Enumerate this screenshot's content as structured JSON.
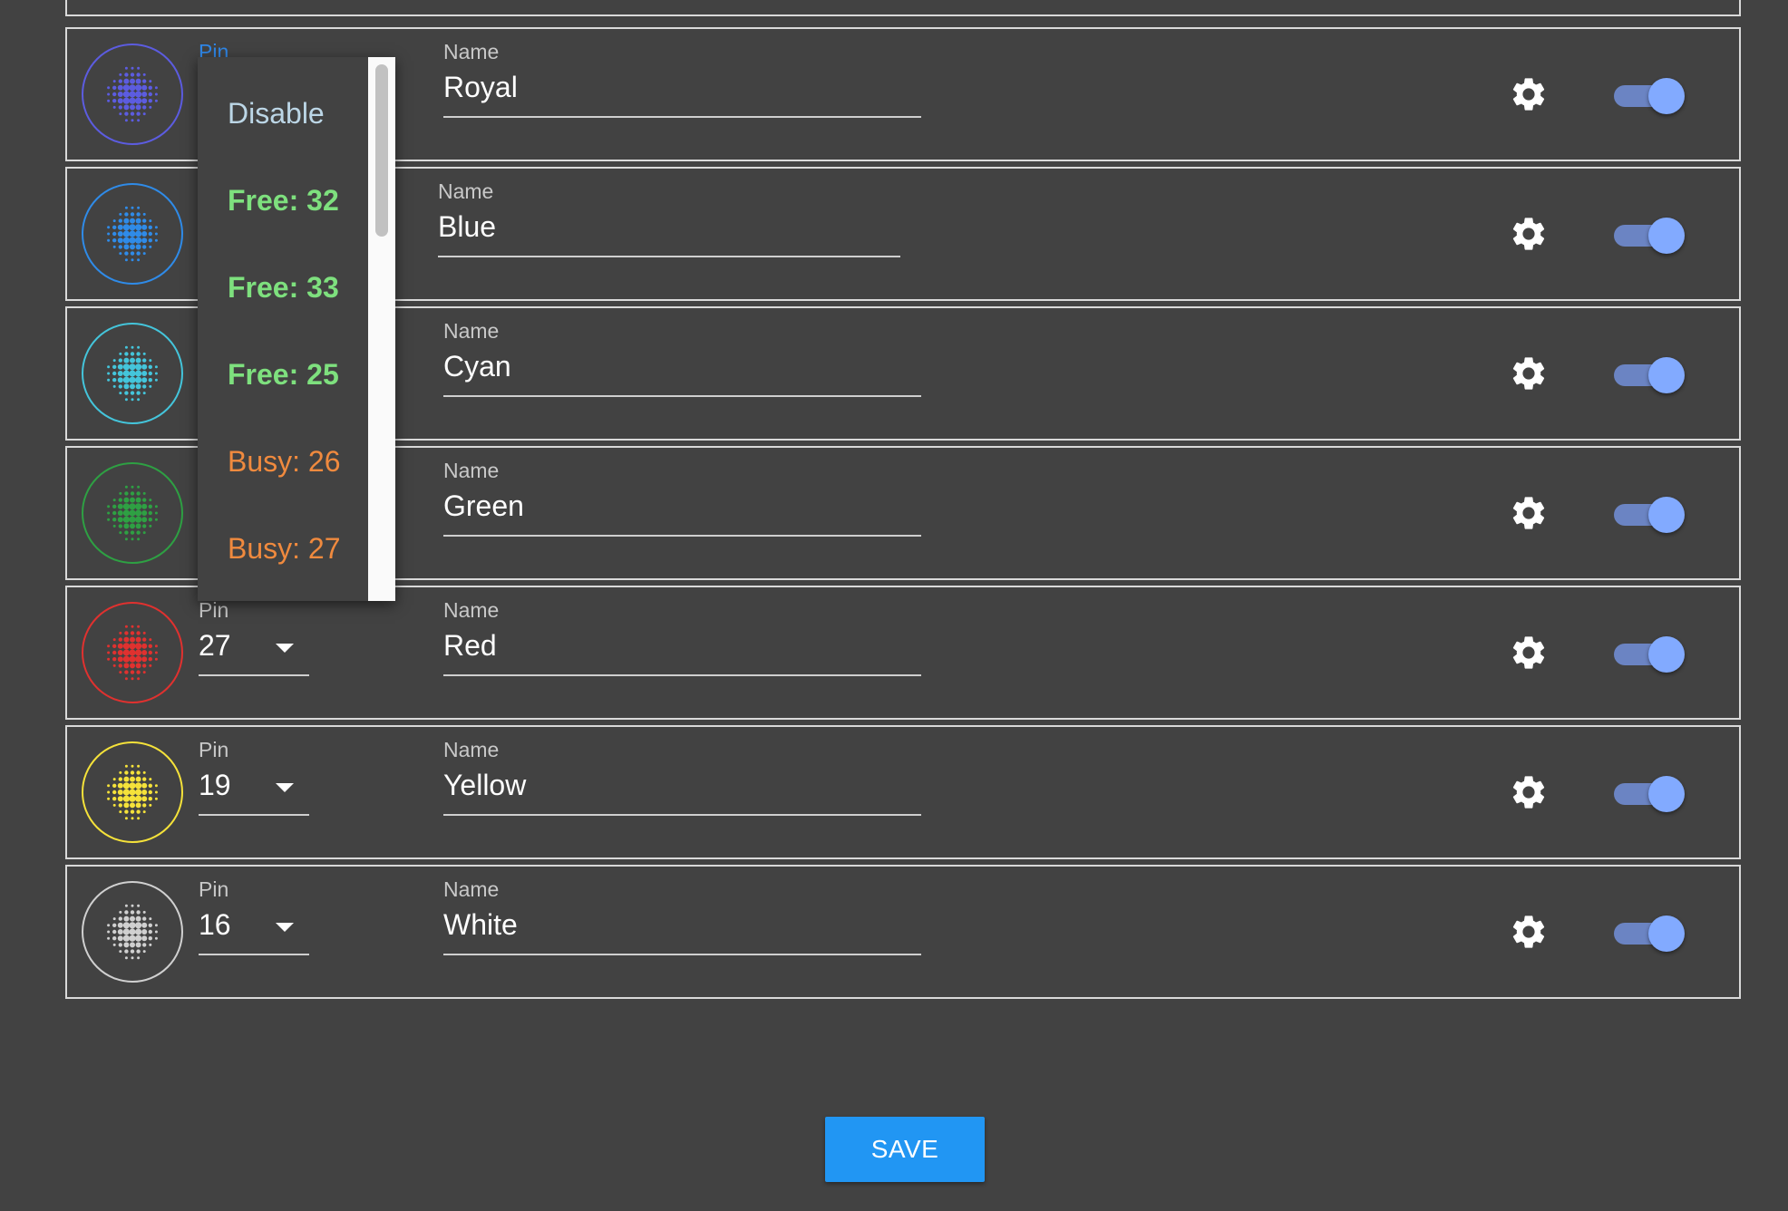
{
  "labels": {
    "pin": "Pin",
    "name": "Name"
  },
  "rows": [
    {
      "pin": "",
      "name": "Royal",
      "color": "#5c5ce0",
      "pin_label_color": "#2f86e6",
      "dropdown_open": true,
      "enabled": true
    },
    {
      "pin": "",
      "name": "Blue",
      "color": "#2f8be8",
      "enabled": true
    },
    {
      "pin": "",
      "name": "Cyan",
      "color": "#44c5db",
      "enabled": true
    },
    {
      "pin": "",
      "name": "Green",
      "color": "#2ea043",
      "enabled": true
    },
    {
      "pin": "27",
      "name": "Red",
      "color": "#e0312f",
      "enabled": true
    },
    {
      "pin": "19",
      "name": "Yellow",
      "color": "#f5e23a",
      "enabled": true
    },
    {
      "pin": "16",
      "name": "White",
      "color": "#d0d0d0",
      "enabled": true
    }
  ],
  "partial_row_color": "#9c27b0",
  "pin_menu": {
    "items": [
      {
        "label": "Disable",
        "status": "disable",
        "color": "#bcd6e6"
      },
      {
        "label": "Free: 32",
        "status": "free",
        "color": "#7ee07e"
      },
      {
        "label": "Free: 33",
        "status": "free",
        "color": "#7ee07e"
      },
      {
        "label": "Free: 25",
        "status": "free",
        "color": "#7ee07e"
      },
      {
        "label": "Busy: 26",
        "status": "busy",
        "color": "#f08a3e"
      },
      {
        "label": "Busy: 27",
        "status": "busy",
        "color": "#f08a3e"
      }
    ]
  },
  "save_label": "SAVE"
}
